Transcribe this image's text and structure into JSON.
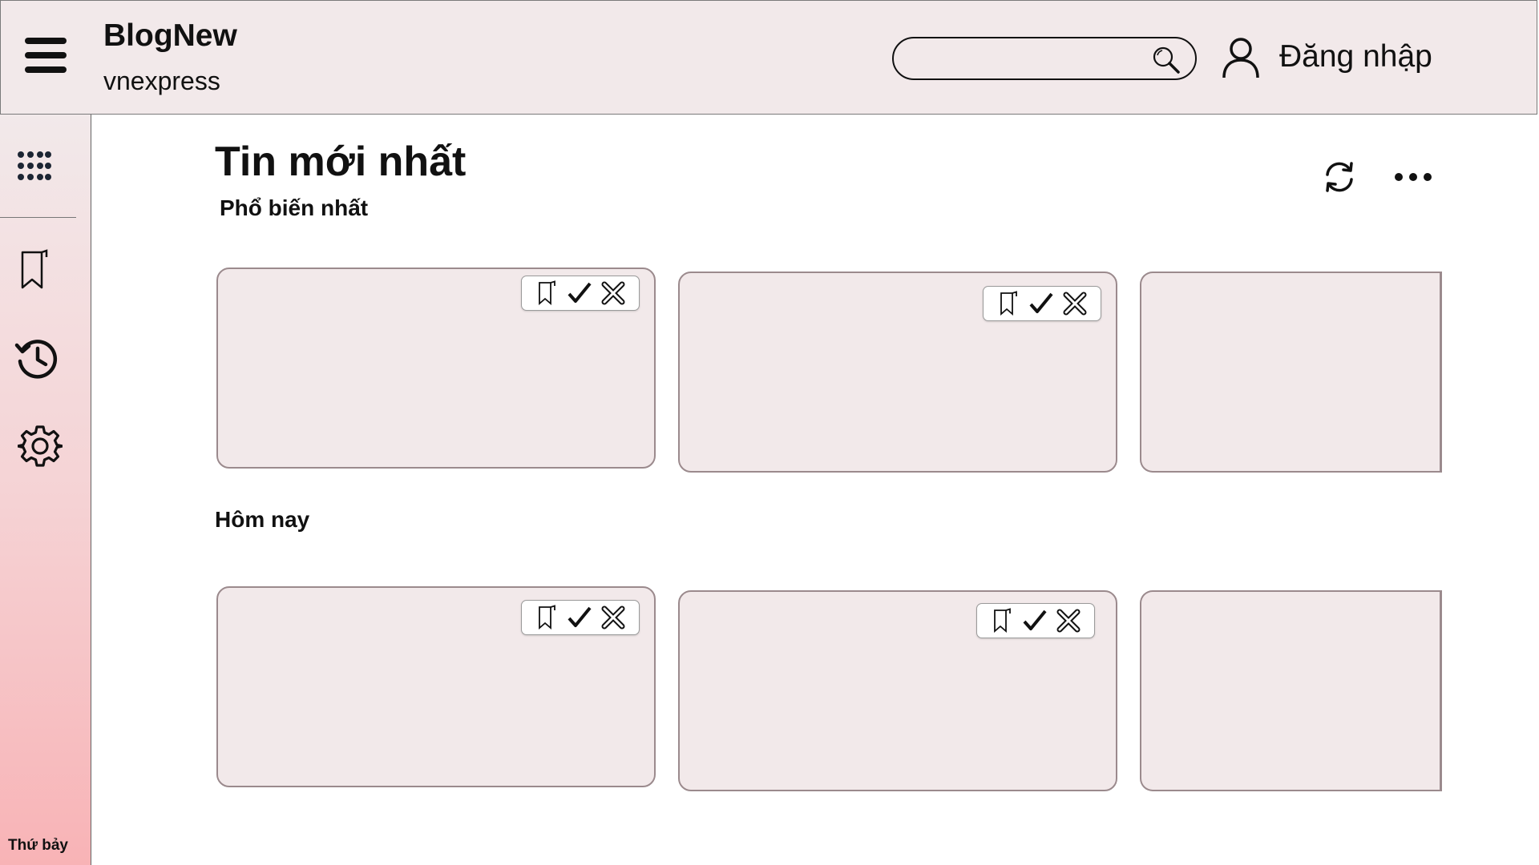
{
  "header": {
    "brand": "BlogNew",
    "brand_sub": "vnexpress",
    "search_placeholder": "",
    "login_label": "Đăng nhập"
  },
  "sidebar": {
    "items": [
      {
        "icon": "apps-grid-icon"
      },
      {
        "icon": "bookmark-icon"
      },
      {
        "icon": "history-icon"
      },
      {
        "icon": "gear-icon"
      }
    ],
    "day_label": "Thứ bảy"
  },
  "main": {
    "title": "Tin mới nhất",
    "sections": [
      {
        "title": "Phổ biến nhất",
        "cards": 3
      },
      {
        "title": "Hôm nay",
        "cards": 3
      }
    ]
  },
  "colors": {
    "header_bg": "#f2e9ea",
    "card_bg": "#f2e9ea",
    "card_border": "#9b8a8d",
    "sidebar_gradient_bottom": "#f8b3b6"
  }
}
